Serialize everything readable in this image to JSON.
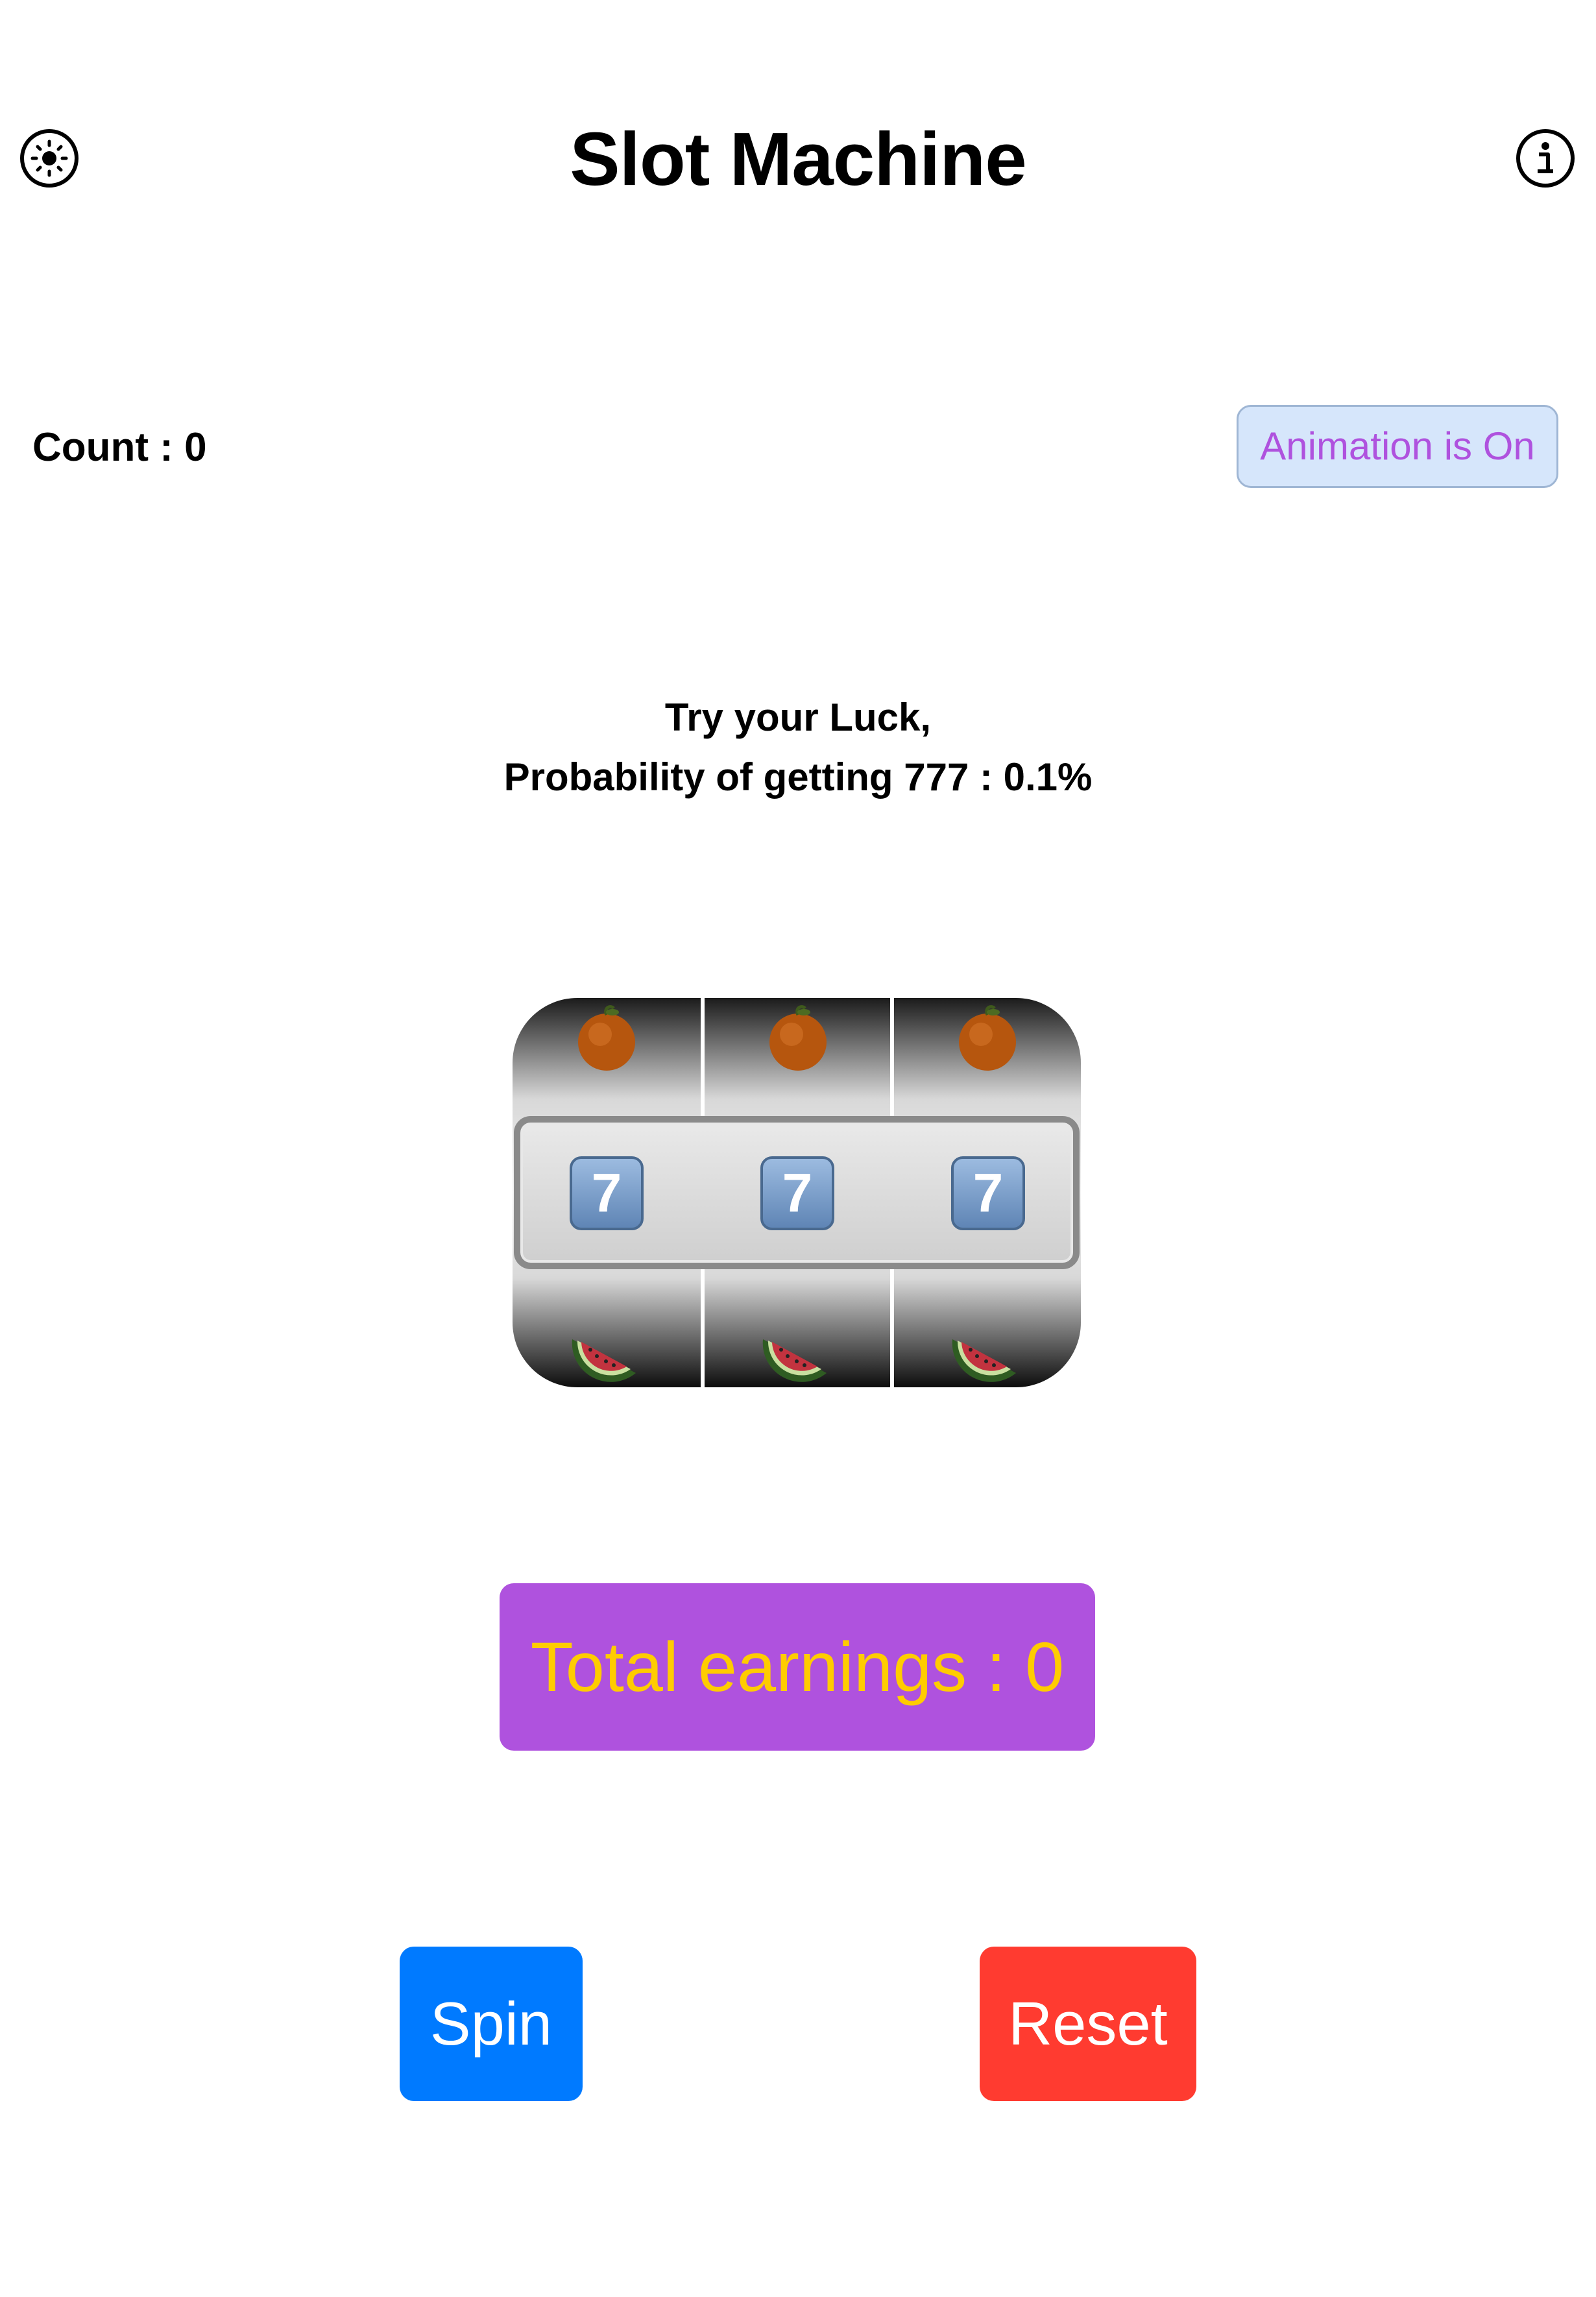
{
  "header": {
    "title": "Slot Machine",
    "left_icon": "brightness-icon",
    "right_icon": "info-icon"
  },
  "stats": {
    "count_label": "Count : 0",
    "animation_toggle_label": "Animation is On"
  },
  "message": {
    "line1": "Try your Luck,",
    "line2": "Probability of getting 777 : 0.1%"
  },
  "slot": {
    "reels": [
      {
        "top": "orange",
        "middle": "7",
        "bottom": "watermelon"
      },
      {
        "top": "orange",
        "middle": "7",
        "bottom": "watermelon"
      },
      {
        "top": "orange",
        "middle": "7",
        "bottom": "watermelon"
      }
    ]
  },
  "earnings": {
    "label": "Total earnings : 0"
  },
  "buttons": {
    "spin_label": "Spin",
    "reset_label": "Reset"
  },
  "colors": {
    "accent_purple": "#af52de",
    "earnings_text": "#ffcc00",
    "spin_blue": "#007aff",
    "reset_red": "#ff3b30",
    "toggle_bg": "#d6e6fb"
  }
}
